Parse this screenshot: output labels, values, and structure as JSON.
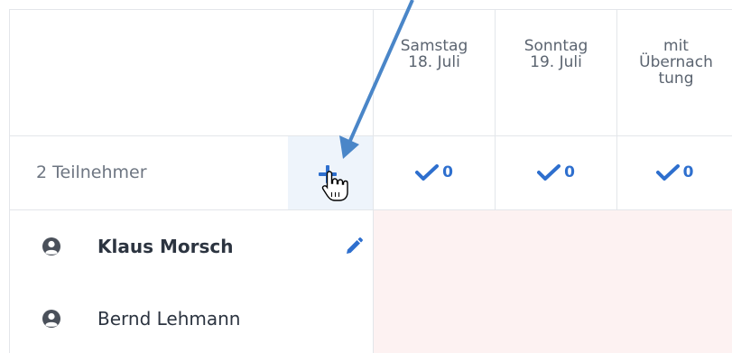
{
  "colors": {
    "accent": "#2e6fce",
    "arrow": "#4a86c8",
    "grid_line": "#e3e6ea",
    "add_cell_bg": "#eef4fb",
    "unavailable_bg": "#fdf2f2"
  },
  "columns": [
    {
      "line1": "Samstag",
      "line2": "18. Juli",
      "line3": ""
    },
    {
      "line1": "Sonntag",
      "line2": "19. Juli",
      "line3": ""
    },
    {
      "line1": "mit",
      "line2": "Übernach",
      "line3": "tung"
    }
  ],
  "summary": {
    "participants_label": "2 Teilnehmer",
    "counts": [
      "0",
      "0",
      "0"
    ],
    "add_icon": "plus-icon"
  },
  "participants": [
    {
      "name": "Klaus Morsch",
      "icon": "user-icon",
      "editable": true
    },
    {
      "name": "Bernd Lehmann",
      "icon": "user-icon",
      "editable": false
    }
  ]
}
